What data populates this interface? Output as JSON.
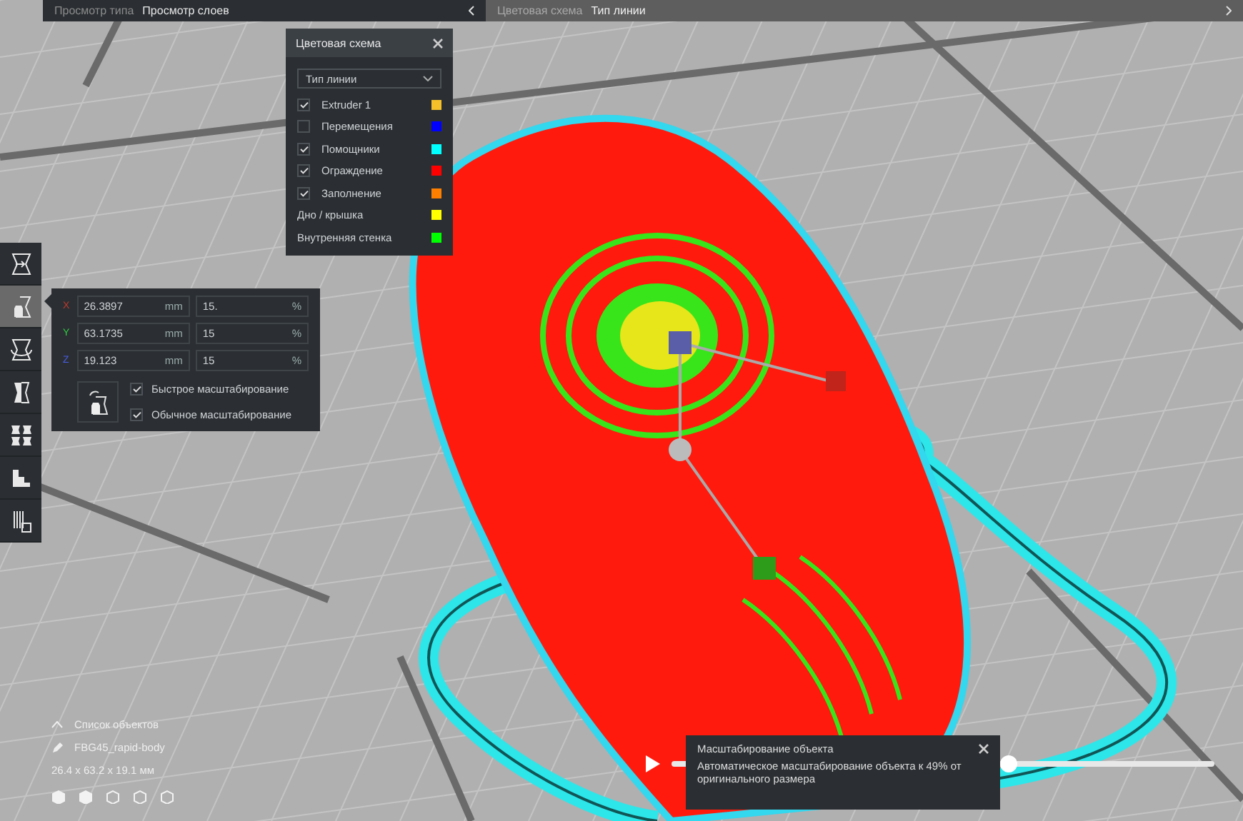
{
  "top_bar": {
    "view_type_label": "Просмотр типа",
    "view_type_value": "Просмотр слоев",
    "color_scheme_label": "Цветовая схема",
    "color_scheme_value": "Тип линии"
  },
  "color_scheme_panel": {
    "title": "Цветовая схема",
    "dropdown": "Тип линии",
    "items": [
      {
        "label": "Extruder 1",
        "kind": "checkbox",
        "checked": true,
        "color": "#f5c02a"
      },
      {
        "label": "Перемещения",
        "kind": "checkbox",
        "checked": false,
        "color": "#0000ff"
      },
      {
        "label": "Помощники",
        "kind": "checkbox",
        "checked": true,
        "color": "#00ffff"
      },
      {
        "label": "Ограждение",
        "kind": "checkbox",
        "checked": true,
        "color": "#ff0000"
      },
      {
        "label": "Заполнение",
        "kind": "checkbox",
        "checked": true,
        "color": "#ff8000"
      },
      {
        "label": "Дно / крышка",
        "kind": "plain",
        "color": "#ffff00"
      },
      {
        "label": "Внутренняя стенка",
        "kind": "plain",
        "color": "#00ff00"
      }
    ]
  },
  "toolbar": [
    {
      "kind": "move",
      "selected": false
    },
    {
      "kind": "scale",
      "selected": true
    },
    {
      "kind": "rotate",
      "selected": false
    },
    {
      "kind": "mirror",
      "selected": false
    },
    {
      "kind": "multiply",
      "selected": false
    },
    {
      "kind": "support",
      "selected": false
    },
    {
      "kind": "settings",
      "selected": false
    }
  ],
  "scale_panel": {
    "axes": [
      {
        "axis": "X",
        "value": "26.3897",
        "unit": "mm",
        "percent": "15.",
        "percent_unit": "%",
        "color": "#c0392b"
      },
      {
        "axis": "Y",
        "value": "63.1735",
        "unit": "mm",
        "percent": "15",
        "percent_unit": "%",
        "color": "#2ecc40"
      },
      {
        "axis": "Z",
        "value": "19.123",
        "unit": "mm",
        "percent": "15",
        "percent_unit": "%",
        "color": "#4a5ee8"
      }
    ],
    "options": [
      {
        "label": "Быстрое масштабирование",
        "checked": true
      },
      {
        "label": "Обычное масштабирование",
        "checked": true
      }
    ]
  },
  "object_list": {
    "title": "Список объектов",
    "expanded": true,
    "object_name": "FBG45_rapid-body",
    "dimensions": "26.4 x 63.2 x 19.1 мм"
  },
  "notification": {
    "title": "Масштабирование объекта",
    "message": "Автоматическое масштабирование объекта к 49% от оригинального размера"
  },
  "layer_slider": {
    "level": 0.62
  }
}
